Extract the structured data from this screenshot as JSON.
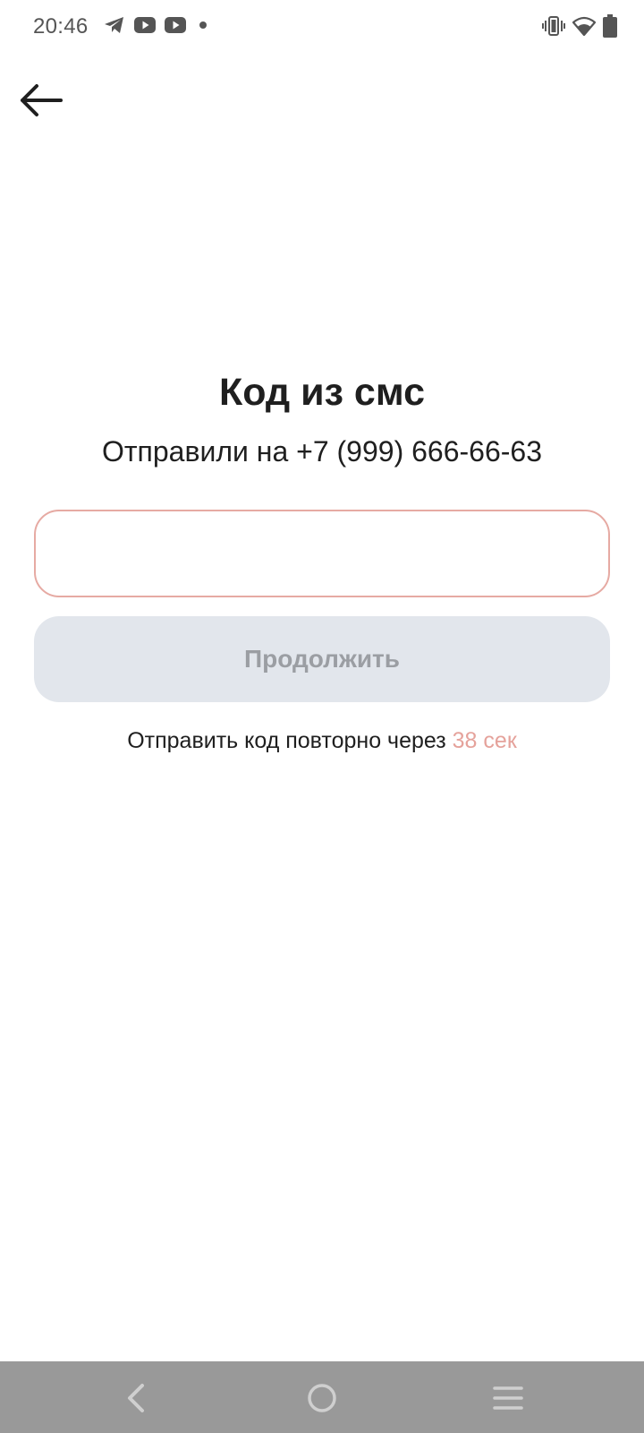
{
  "status_bar": {
    "time": "20:46",
    "left_icons": [
      "telegram-icon",
      "youtube-icon",
      "youtube-icon",
      "notification-dot-icon"
    ],
    "right_icons": [
      "vibrate-icon",
      "wifi-icon",
      "battery-icon"
    ]
  },
  "header": {
    "back_icon": "arrow-left-icon"
  },
  "main": {
    "title": "Код из смс",
    "subtitle": "Отправили на +7 (999) 666-66-63",
    "code_input": {
      "value": "",
      "placeholder": ""
    },
    "continue_label": "Продолжить",
    "resend_text": "Отправить код повторно через",
    "resend_timer": "38 сек"
  },
  "nav_bar": {
    "buttons": [
      "nav-back-icon",
      "nav-home-icon",
      "nav-menu-icon"
    ]
  },
  "colors": {
    "accent": "#e5a29b",
    "input_border": "#e6aaa3",
    "button_bg": "#e2e6ec",
    "button_text": "#9b9ea3",
    "nav_bar_bg": "#999999"
  }
}
